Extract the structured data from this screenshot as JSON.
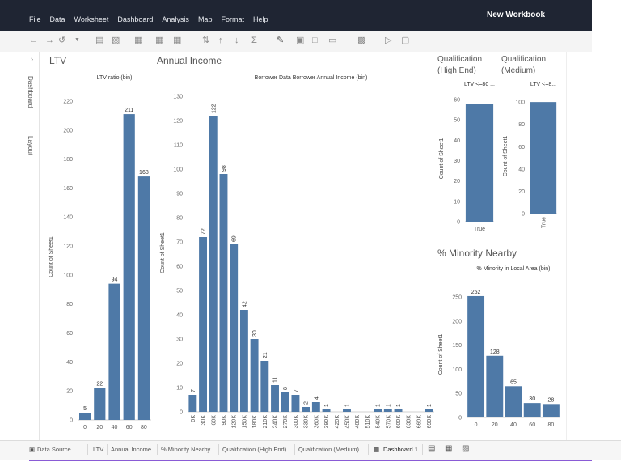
{
  "app": {
    "workbook_title": "New Workbook",
    "menu": [
      "File",
      "Data",
      "Worksheet",
      "Dashboard",
      "Analysis",
      "Map",
      "Format",
      "Help"
    ]
  },
  "sidebar": {
    "dashboard_label": "Dashboard",
    "layout_label": "Layout"
  },
  "dashboard": {
    "ltv_title": "LTV",
    "income_title": "Annual Income",
    "qual_high_title": "Qualification\n(High End)",
    "qual_medium_title": "Qualification\n(Medium)",
    "minority_title": "% Minority Nearby"
  },
  "colors": {
    "bar": "#4e79a7",
    "titlebar": "#1f2533"
  },
  "chart_data": [
    {
      "id": "ltv",
      "type": "bar",
      "title": "LTV ratio (bin)",
      "ylabel": "Count of Sheet1",
      "categories": [
        "0",
        "20",
        "40",
        "60",
        "80"
      ],
      "values": [
        5,
        22,
        94,
        211,
        168
      ],
      "yticks": [
        0,
        20,
        40,
        60,
        80,
        100,
        120,
        140,
        160,
        180,
        200,
        220
      ],
      "ylim": [
        0,
        225
      ]
    },
    {
      "id": "income",
      "type": "bar",
      "title": "Borrower Data Borrower Annual Income (bin)",
      "ylabel": "Count of Sheet1",
      "categories": [
        "0K",
        "30K",
        "60K",
        "90K",
        "120K",
        "150K",
        "180K",
        "210K",
        "240K",
        "270K",
        "300K",
        "330K",
        "360K",
        "390K",
        "420K",
        "450K",
        "480K",
        "510K",
        "540K",
        "570K",
        "600K",
        "630K",
        "660K",
        "690K"
      ],
      "values": [
        7,
        72,
        122,
        98,
        69,
        42,
        30,
        21,
        11,
        8,
        7,
        2,
        4,
        1,
        0,
        1,
        0,
        0,
        1,
        1,
        1,
        0,
        0,
        1
      ],
      "yticks": [
        0,
        10,
        20,
        30,
        40,
        50,
        60,
        70,
        80,
        90,
        100,
        110,
        120,
        130
      ],
      "ylim": [
        0,
        131
      ]
    },
    {
      "id": "qual_high",
      "type": "bar",
      "title": "LTV <=80 ...",
      "ylabel": "Count of Sheet1",
      "categories": [
        "True"
      ],
      "values": [
        58
      ],
      "yticks": [
        0,
        10,
        20,
        30,
        40,
        50,
        60
      ],
      "ylim": [
        0,
        62
      ]
    },
    {
      "id": "qual_medium",
      "type": "bar",
      "title": "LTV <=8...",
      "ylabel": "Count of Sheet1",
      "categories": [
        "True"
      ],
      "values": [
        100
      ],
      "yticks": [
        0,
        20,
        40,
        60,
        80,
        100
      ],
      "ylim": [
        0,
        103
      ]
    },
    {
      "id": "minority",
      "type": "bar",
      "title": "% Minority in Local Area (bin)",
      "ylabel": "Count of Sheet1",
      "categories": [
        "0",
        "20",
        "40",
        "60",
        "80"
      ],
      "values": [
        252,
        128,
        65,
        30,
        28
      ],
      "yticks": [
        0,
        50,
        100,
        150,
        200,
        250
      ],
      "ylim": [
        0,
        262
      ]
    }
  ],
  "tabs": [
    {
      "label": "Data Source",
      "active": false
    },
    {
      "label": "LTV",
      "active": false
    },
    {
      "label": "Annual Income",
      "active": false
    },
    {
      "label": "% Minority Nearby",
      "active": false
    },
    {
      "label": "Qualification (High End)",
      "active": false
    },
    {
      "label": "Qualification (Medium)",
      "active": false
    },
    {
      "label": "Dashboard 1",
      "active": true
    }
  ]
}
